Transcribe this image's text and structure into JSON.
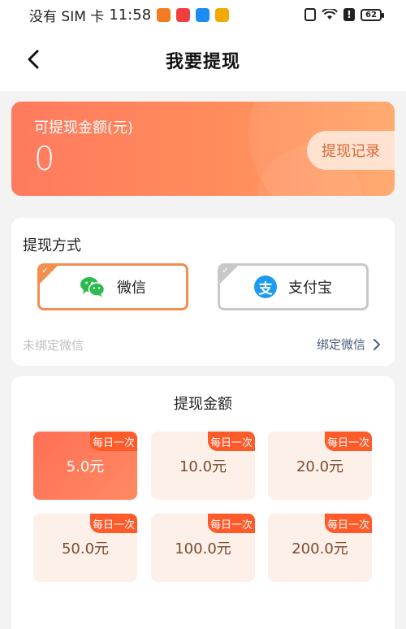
{
  "status_bar": {
    "carrier": "没有 SIM 卡",
    "time": "11:58",
    "alert_glyph": "!",
    "battery": "62"
  },
  "header": {
    "title": "我要提现"
  },
  "balance": {
    "label": "可提现金额(元)",
    "value": "0",
    "records_button": "提现记录"
  },
  "method": {
    "title": "提现方式",
    "options": [
      {
        "label": "微信",
        "icon": "wechat-icon",
        "selected": true
      },
      {
        "label": "支付宝",
        "icon": "alipay-icon",
        "selected": false
      }
    ],
    "alipay_glyph": "支",
    "bind_status": "未绑定微信",
    "bind_link": "绑定微信"
  },
  "amount": {
    "title": "提现金额",
    "tiles": [
      {
        "value": "5.0元",
        "badge": "每日一次",
        "selected": true
      },
      {
        "value": "10.0元",
        "badge": "每日一次",
        "selected": false
      },
      {
        "value": "20.0元",
        "badge": "每日一次",
        "selected": false
      },
      {
        "value": "50.0元",
        "badge": "每日一次",
        "selected": false
      },
      {
        "value": "100.0元",
        "badge": "每日一次",
        "selected": false
      },
      {
        "value": "200.0元",
        "badge": "每日一次",
        "selected": false
      }
    ]
  },
  "colors": {
    "accent": "#f38e4e",
    "badge": "#ff5a2a",
    "link": "#4a5d7a"
  }
}
